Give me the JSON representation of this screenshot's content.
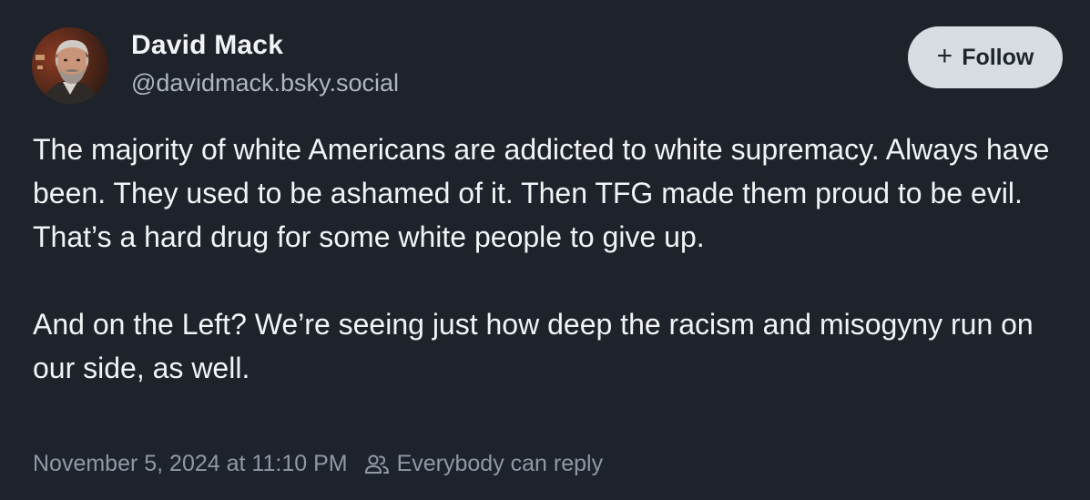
{
  "author": {
    "display_name": "David Mack",
    "handle": "@davidmack.bsky.social"
  },
  "follow_button": {
    "icon": "plus-icon",
    "label": "Follow"
  },
  "post": {
    "paragraphs": [
      "The majority of white Americans are addicted to white supremacy. Always have been. They used to be ashamed of it. Then TFG made them proud to be evil. That’s a hard drug for some white people to give up.",
      "And on the Left? We’re seeing just how deep the racism and misogyny run on our side, as well."
    ]
  },
  "meta": {
    "timestamp": "November 5, 2024 at 11:10 PM",
    "reply_icon": "people-icon",
    "reply_setting": "Everybody can reply"
  },
  "colors": {
    "background": "#1d222b",
    "text": "#f1f3f5",
    "muted": "#8f99a6",
    "button": "#d8dde3"
  }
}
